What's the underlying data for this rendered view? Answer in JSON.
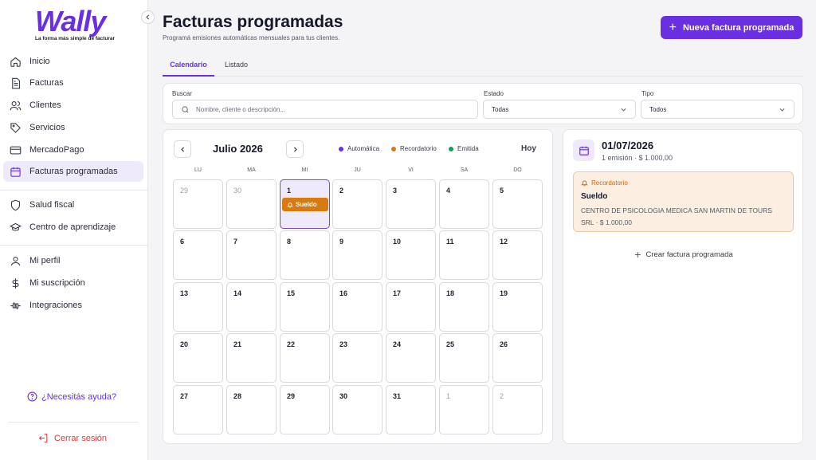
{
  "brand": {
    "name": "Wally",
    "tagline": "La forma más simple de facturar",
    "accent": "#6a2fe0"
  },
  "sidebar": {
    "items": [
      {
        "label": "Inicio",
        "icon": "home-icon"
      },
      {
        "label": "Facturas",
        "icon": "document-icon"
      },
      {
        "label": "Clientes",
        "icon": "users-icon"
      },
      {
        "label": "Servicios",
        "icon": "tag-icon"
      },
      {
        "label": "MercadoPago",
        "icon": "card-icon"
      },
      {
        "label": "Facturas programadas",
        "icon": "calendar-icon",
        "active": true
      },
      {
        "label": "Salud fiscal",
        "icon": "shield-icon"
      },
      {
        "label": "Centro de aprendizaje",
        "icon": "graduation-cap-icon"
      },
      {
        "label": "Mi perfil",
        "icon": "user-icon"
      },
      {
        "label": "Mi suscripción",
        "icon": "dollar-icon"
      },
      {
        "label": "Integraciones",
        "icon": "plug-icon"
      }
    ],
    "help": "¿Necesitás ayuda?",
    "logout": "Cerrar sesión"
  },
  "header": {
    "title": "Facturas programadas",
    "subtitle": "Programá emisiones automáticas mensuales para tus clientes.",
    "new_button": "Nueva factura programada"
  },
  "tabs": [
    {
      "label": "Calendario",
      "active": true
    },
    {
      "label": "Listado",
      "active": false
    }
  ],
  "filters": {
    "search": {
      "label": "Buscar",
      "placeholder": "Nombre, cliente o descripción..."
    },
    "estado": {
      "label": "Estado",
      "value": "Todas"
    },
    "tipo": {
      "label": "Tipo",
      "value": "Todos"
    }
  },
  "calendar": {
    "month": "Julio 2026",
    "legend": [
      {
        "label": "Automática",
        "color": "#6a2fe0"
      },
      {
        "label": "Recordatorio",
        "color": "#d97a10"
      },
      {
        "label": "Emitida",
        "color": "#169c5a"
      }
    ],
    "today_button": "Hoy",
    "weekdays": [
      "LU",
      "MA",
      "MI",
      "JU",
      "VI",
      "SA",
      "DO"
    ],
    "weeks": [
      [
        "29",
        "30",
        "1",
        "2",
        "3",
        "4",
        "5"
      ],
      [
        "6",
        "7",
        "8",
        "9",
        "10",
        "11",
        "12"
      ],
      [
        "13",
        "14",
        "15",
        "16",
        "17",
        "18",
        "19"
      ],
      [
        "20",
        "21",
        "22",
        "23",
        "24",
        "25",
        "26"
      ],
      [
        "27",
        "28",
        "29",
        "30",
        "31",
        "1",
        "2"
      ]
    ],
    "selected_day": "1",
    "event": {
      "day": "1",
      "label": "Sueldo",
      "color": "#d97a10"
    }
  },
  "detail": {
    "date": "01/07/2026",
    "summary": "1 emisión · $ 1.000,00",
    "card": {
      "type": "Recordatorio",
      "name": "Sueldo",
      "description": "CENTRO DE PSICOLOGIA MEDICA SAN MARTIN DE TOURS SRL · $ 1.000,00"
    },
    "create_label": "Crear factura programada"
  }
}
